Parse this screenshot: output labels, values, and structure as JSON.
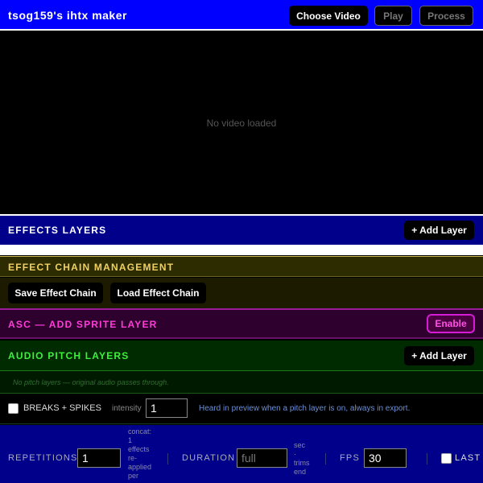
{
  "header": {
    "title": "tsog159's ihtx maker",
    "choose_video": "Choose Video",
    "play": "Play",
    "process": "Process"
  },
  "video": {
    "empty_message": "No video loaded"
  },
  "effects_layers": {
    "title": "EFFECTS LAYERS",
    "add_layer": "+ Add Layer"
  },
  "effect_chain": {
    "title": "EFFECT CHAIN MANAGEMENT",
    "save": "Save Effect Chain",
    "load": "Load Effect Chain"
  },
  "asc": {
    "title": "ASC — ADD SPRITE LAYER",
    "enable": "Enable"
  },
  "audio_pitch": {
    "title": "AUDIO PITCH LAYERS",
    "add_layer": "+ Add Layer",
    "note": "No pitch layers — original audio passes through.",
    "breaks_label": "BREAKS + SPIKES",
    "intensity_label": "intensity",
    "intensity_value": "1",
    "hint": "Heard in preview when a pitch layer is on, always in export."
  },
  "bottom": {
    "repetitions_label": "REPETITIONS",
    "repetitions_value": "1",
    "concat_note": [
      "concat:",
      "1",
      "effects",
      "re-",
      "applied",
      "per"
    ],
    "duration_label": "DURATION",
    "duration_placeholder": "full",
    "sec_note": [
      "sec",
      "·",
      "trims",
      "end"
    ],
    "fps_label": "FPS",
    "fps_value": "30",
    "last_label": "LAST F"
  },
  "colors": {
    "header_bg": "#0000ff",
    "effects_bg": "#00008b",
    "chain_title": "#f0d060",
    "asc_title": "#ff3cd9",
    "audio_title": "#3cf03c"
  }
}
